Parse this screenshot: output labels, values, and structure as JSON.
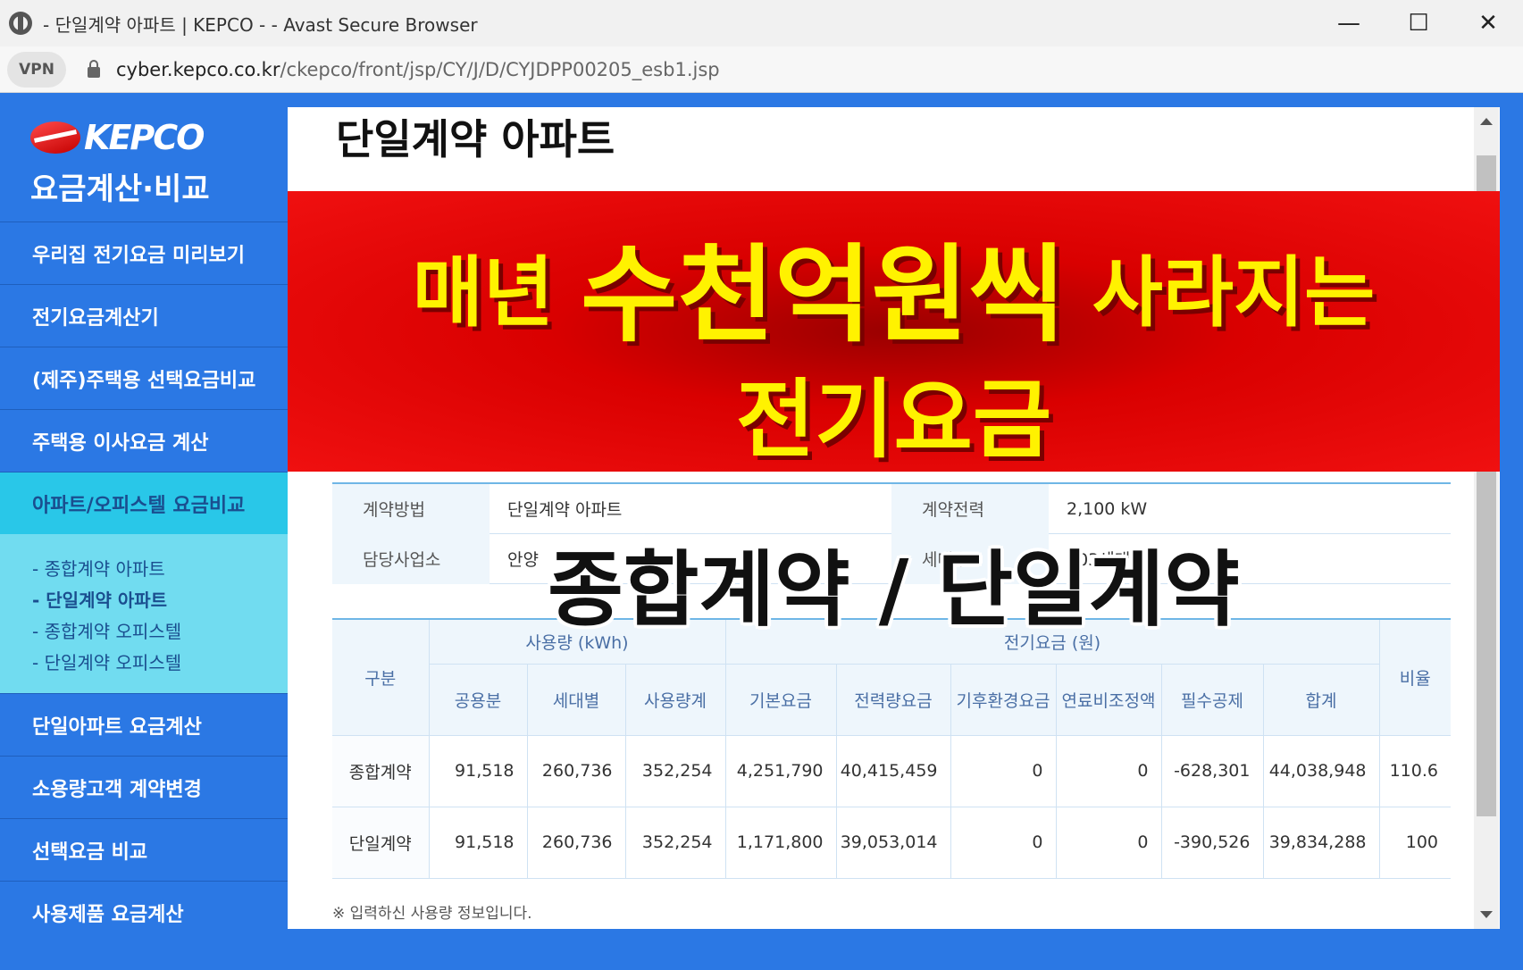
{
  "browser": {
    "title": "- 단일계약 아파트 | KEPCO - - Avast Secure Browser",
    "vpn_label": "VPN",
    "url_host": "cyber.kepco.co.kr",
    "url_path": "/ckepco/front/jsp/CY/J/D/CYJDPP00205_esb1.jsp",
    "minimize": "—",
    "maximize": "☐",
    "close": "✕"
  },
  "sidebar": {
    "logo_text": "KEPCO",
    "subtitle": "요금계산·비교",
    "items": [
      {
        "label": "우리집 전기요금 미리보기"
      },
      {
        "label": "전기요금계산기"
      },
      {
        "label": "(제주)주택용 선택요금비교"
      },
      {
        "label": "주택용 이사요금 계산"
      },
      {
        "label": "아파트/오피스텔 요금비교"
      },
      {
        "label": "단일아파트 요금계산"
      },
      {
        "label": "소용량고객 계약변경"
      },
      {
        "label": "선택요금 비교"
      },
      {
        "label": "사용제품 요금계산"
      }
    ],
    "subitems": [
      {
        "label": "- 종합계약 아파트"
      },
      {
        "label": "- 단일계약 아파트"
      },
      {
        "label": "- 종합계약 오피스텔"
      },
      {
        "label": "- 단일계약 오피스텔"
      }
    ]
  },
  "main": {
    "title": "단일계약 아파트",
    "info": {
      "contract_method_label": "계약방법",
      "contract_method_value": "단일계약 아파트",
      "contract_power_label": "계약전력",
      "contract_power_value": "2,100 kW",
      "office_label": "담당사업소",
      "office_value": "안양",
      "households_label": "세대수",
      "households_value": "303세대"
    },
    "table": {
      "group_label": "구분",
      "usage_group": "사용량 (kWh)",
      "fee_group": "전기요금 (원)",
      "ratio": "비율",
      "columns": [
        "공용분",
        "세대별",
        "사용량계",
        "기본요금",
        "전력량요금",
        "기후환경요금",
        "연료비조정액",
        "필수공제",
        "합계"
      ],
      "rows": [
        {
          "label": "종합계약",
          "values": [
            "91,518",
            "260,736",
            "352,254",
            "4,251,790",
            "40,415,459",
            "0",
            "0",
            "-628,301",
            "44,038,948",
            "110.6"
          ]
        },
        {
          "label": "단일계약",
          "values": [
            "91,518",
            "260,736",
            "352,254",
            "1,171,800",
            "39,053,014",
            "0",
            "0",
            "-390,526",
            "39,834,288",
            "100"
          ]
        }
      ]
    },
    "note": "※ 입력하신 사용량 정보입니다."
  },
  "overlay": {
    "banner_pre": "매년 ",
    "banner_big": "수천억원씩",
    "banner_post": " 사라지는",
    "banner_line2": "전기요금",
    "caption": "종합계약 / 단일계약"
  }
}
